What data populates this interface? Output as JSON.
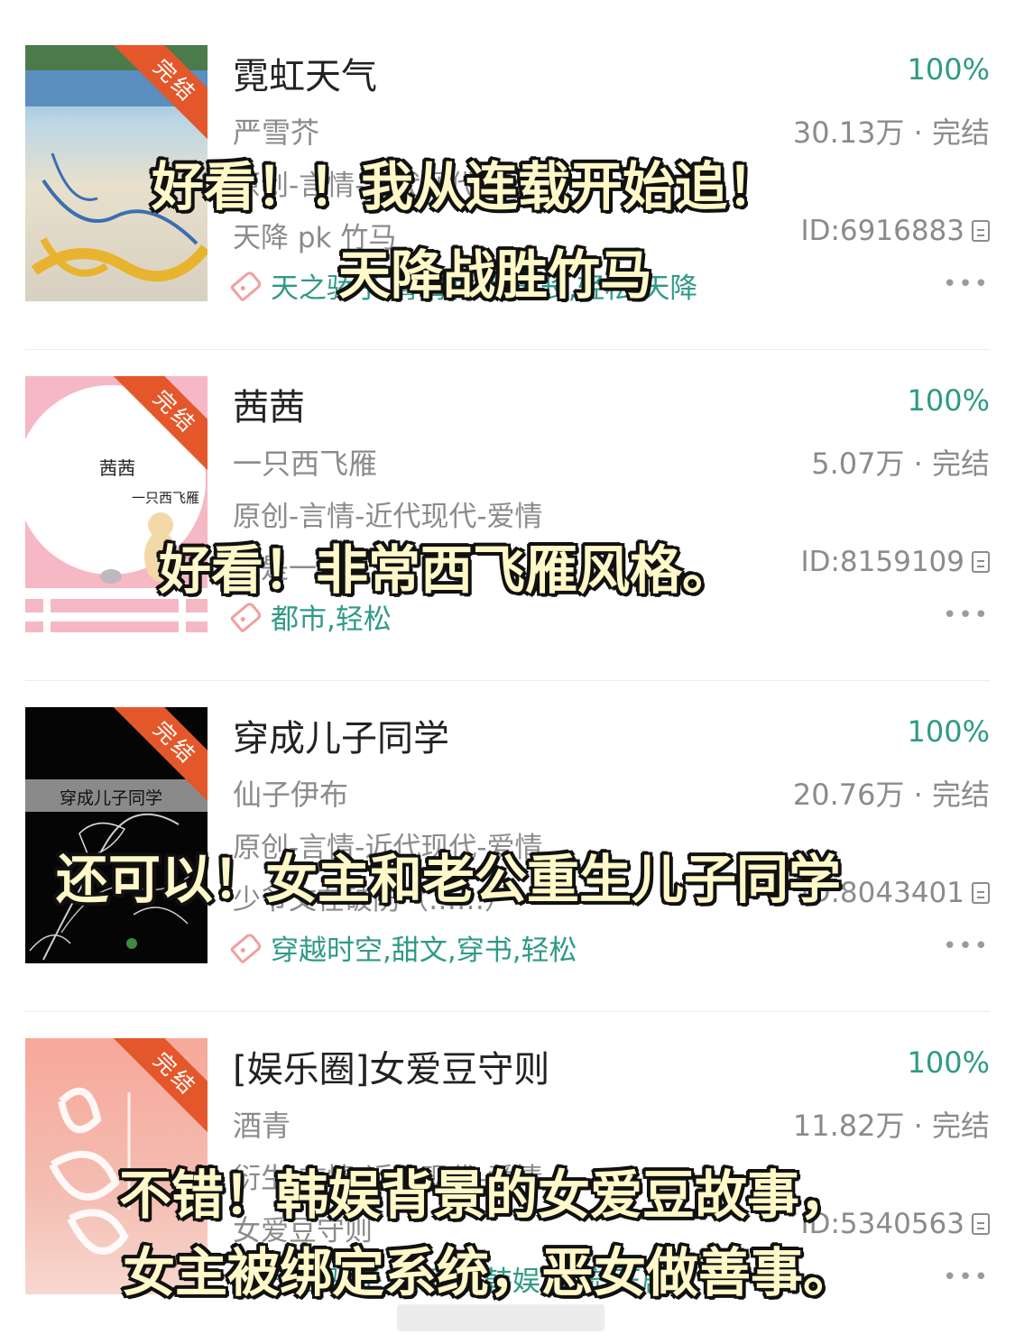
{
  "books": [
    {
      "cover_badge": "完结",
      "title": "霓虹天气",
      "progress": "100%",
      "author": "严雪芥",
      "stats": "30.13万 · 完结",
      "category": "原创-言情-近代现代-爱情",
      "description": "天降 pk 竹马",
      "id": "ID:6916883",
      "tags": "天之骄子,青梅竹马,成长,轻松,天降",
      "more": "•••"
    },
    {
      "cover_badge": "完结",
      "cover_title": "茜茜",
      "cover_author": "一只西飞雁",
      "title": "茜茜",
      "progress": "100%",
      "author": "一只西飞雁",
      "stats": "5.07万 · 完结",
      "category": "原创-言情-近代现代-爱情",
      "description": "我是一个",
      "id": "ID:8159109",
      "tags": "都市,轻松",
      "more": "•••"
    },
    {
      "cover_badge": "完结",
      "cover_title": "穿成儿子同学",
      "title": "穿成儿子同学",
      "progress": "100%",
      "author": "仙子伊布",
      "stats": "20.76万 · 完结",
      "category": "原创-言情-近代现代-爱情",
      "description": "少爷文在破防（……）",
      "id": "ID:8043401",
      "tags": "穿越时空,甜文,穿书,轻松",
      "more": "•••"
    },
    {
      "cover_badge": "完结",
      "title": "[娱乐圈]女爱豆守则",
      "progress": "100%",
      "author": "酒青",
      "stats": "11.82万 · 完结",
      "category": "衍生-言情-近代现代-爱情",
      "description": "女爱豆守则",
      "id": "ID:5340563",
      "tags": "天之骄子,娱乐圈,韩娱,系统,正剧",
      "more": "•••"
    }
  ],
  "overlays": [
    "好看！！我从连载开始追！",
    "天降战胜竹马",
    "好看！非常西飞雁风格。",
    "还可以！女主和老公重生儿子同学",
    "不错！韩娱背景的女爱豆故事，",
    "女主被绑定系统，恶女做善事。"
  ],
  "colors": {
    "accent_green": "#2f9a86",
    "badge_orange": "#e4572a",
    "tag_icon_pink": "#f0a0a0",
    "secondary_text": "#8b8b8b"
  }
}
